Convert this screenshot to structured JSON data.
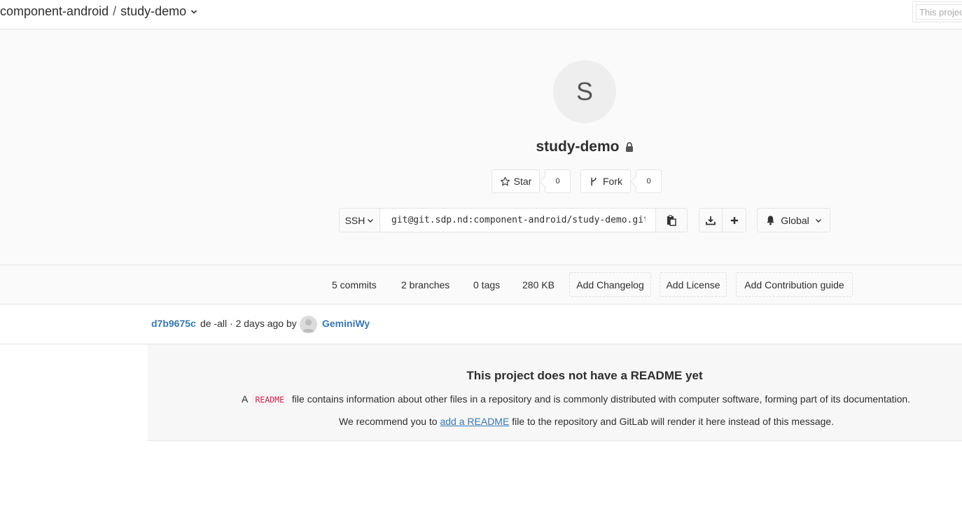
{
  "breadcrumb": {
    "group": "component-android",
    "separator": "/",
    "project": "study-demo"
  },
  "search": {
    "placeholder": "This project"
  },
  "project": {
    "avatar_letter": "S",
    "name": "study-demo",
    "visibility_icon": "lock-icon"
  },
  "actions": {
    "star_label": "Star",
    "star_count": "0",
    "fork_label": "Fork",
    "fork_count": "0"
  },
  "clone": {
    "protocol": "SSH",
    "url": "git@git.sdp.nd:component-android/study-demo.git"
  },
  "notifications": {
    "label": "Global"
  },
  "stats": {
    "commits": "5 commits",
    "branches": "2 branches",
    "tags": "0 tags",
    "size": "280 KB",
    "add_changelog": "Add Changelog",
    "add_license": "Add License",
    "add_contribution": "Add Contribution guide"
  },
  "last_commit": {
    "sha": "d7b9675c",
    "message": "de -all · 2 days ago by",
    "author": "GeminiWy"
  },
  "readme": {
    "title": "This project does not have a README yet",
    "p1_prefix": "A",
    "p1_code": "README",
    "p1_suffix": "file contains information about other files in a repository and is commonly distributed with computer software, forming part of its documentation.",
    "p2_prefix": "We recommend you to",
    "p2_link": "add a README",
    "p2_suffix": "file to the repository and GitLab will render it here instead of this message."
  },
  "colors": {
    "link": "#3777b0",
    "code": "#c7254e",
    "panel_bg": "#fafafa",
    "border": "#e5e5e5"
  }
}
